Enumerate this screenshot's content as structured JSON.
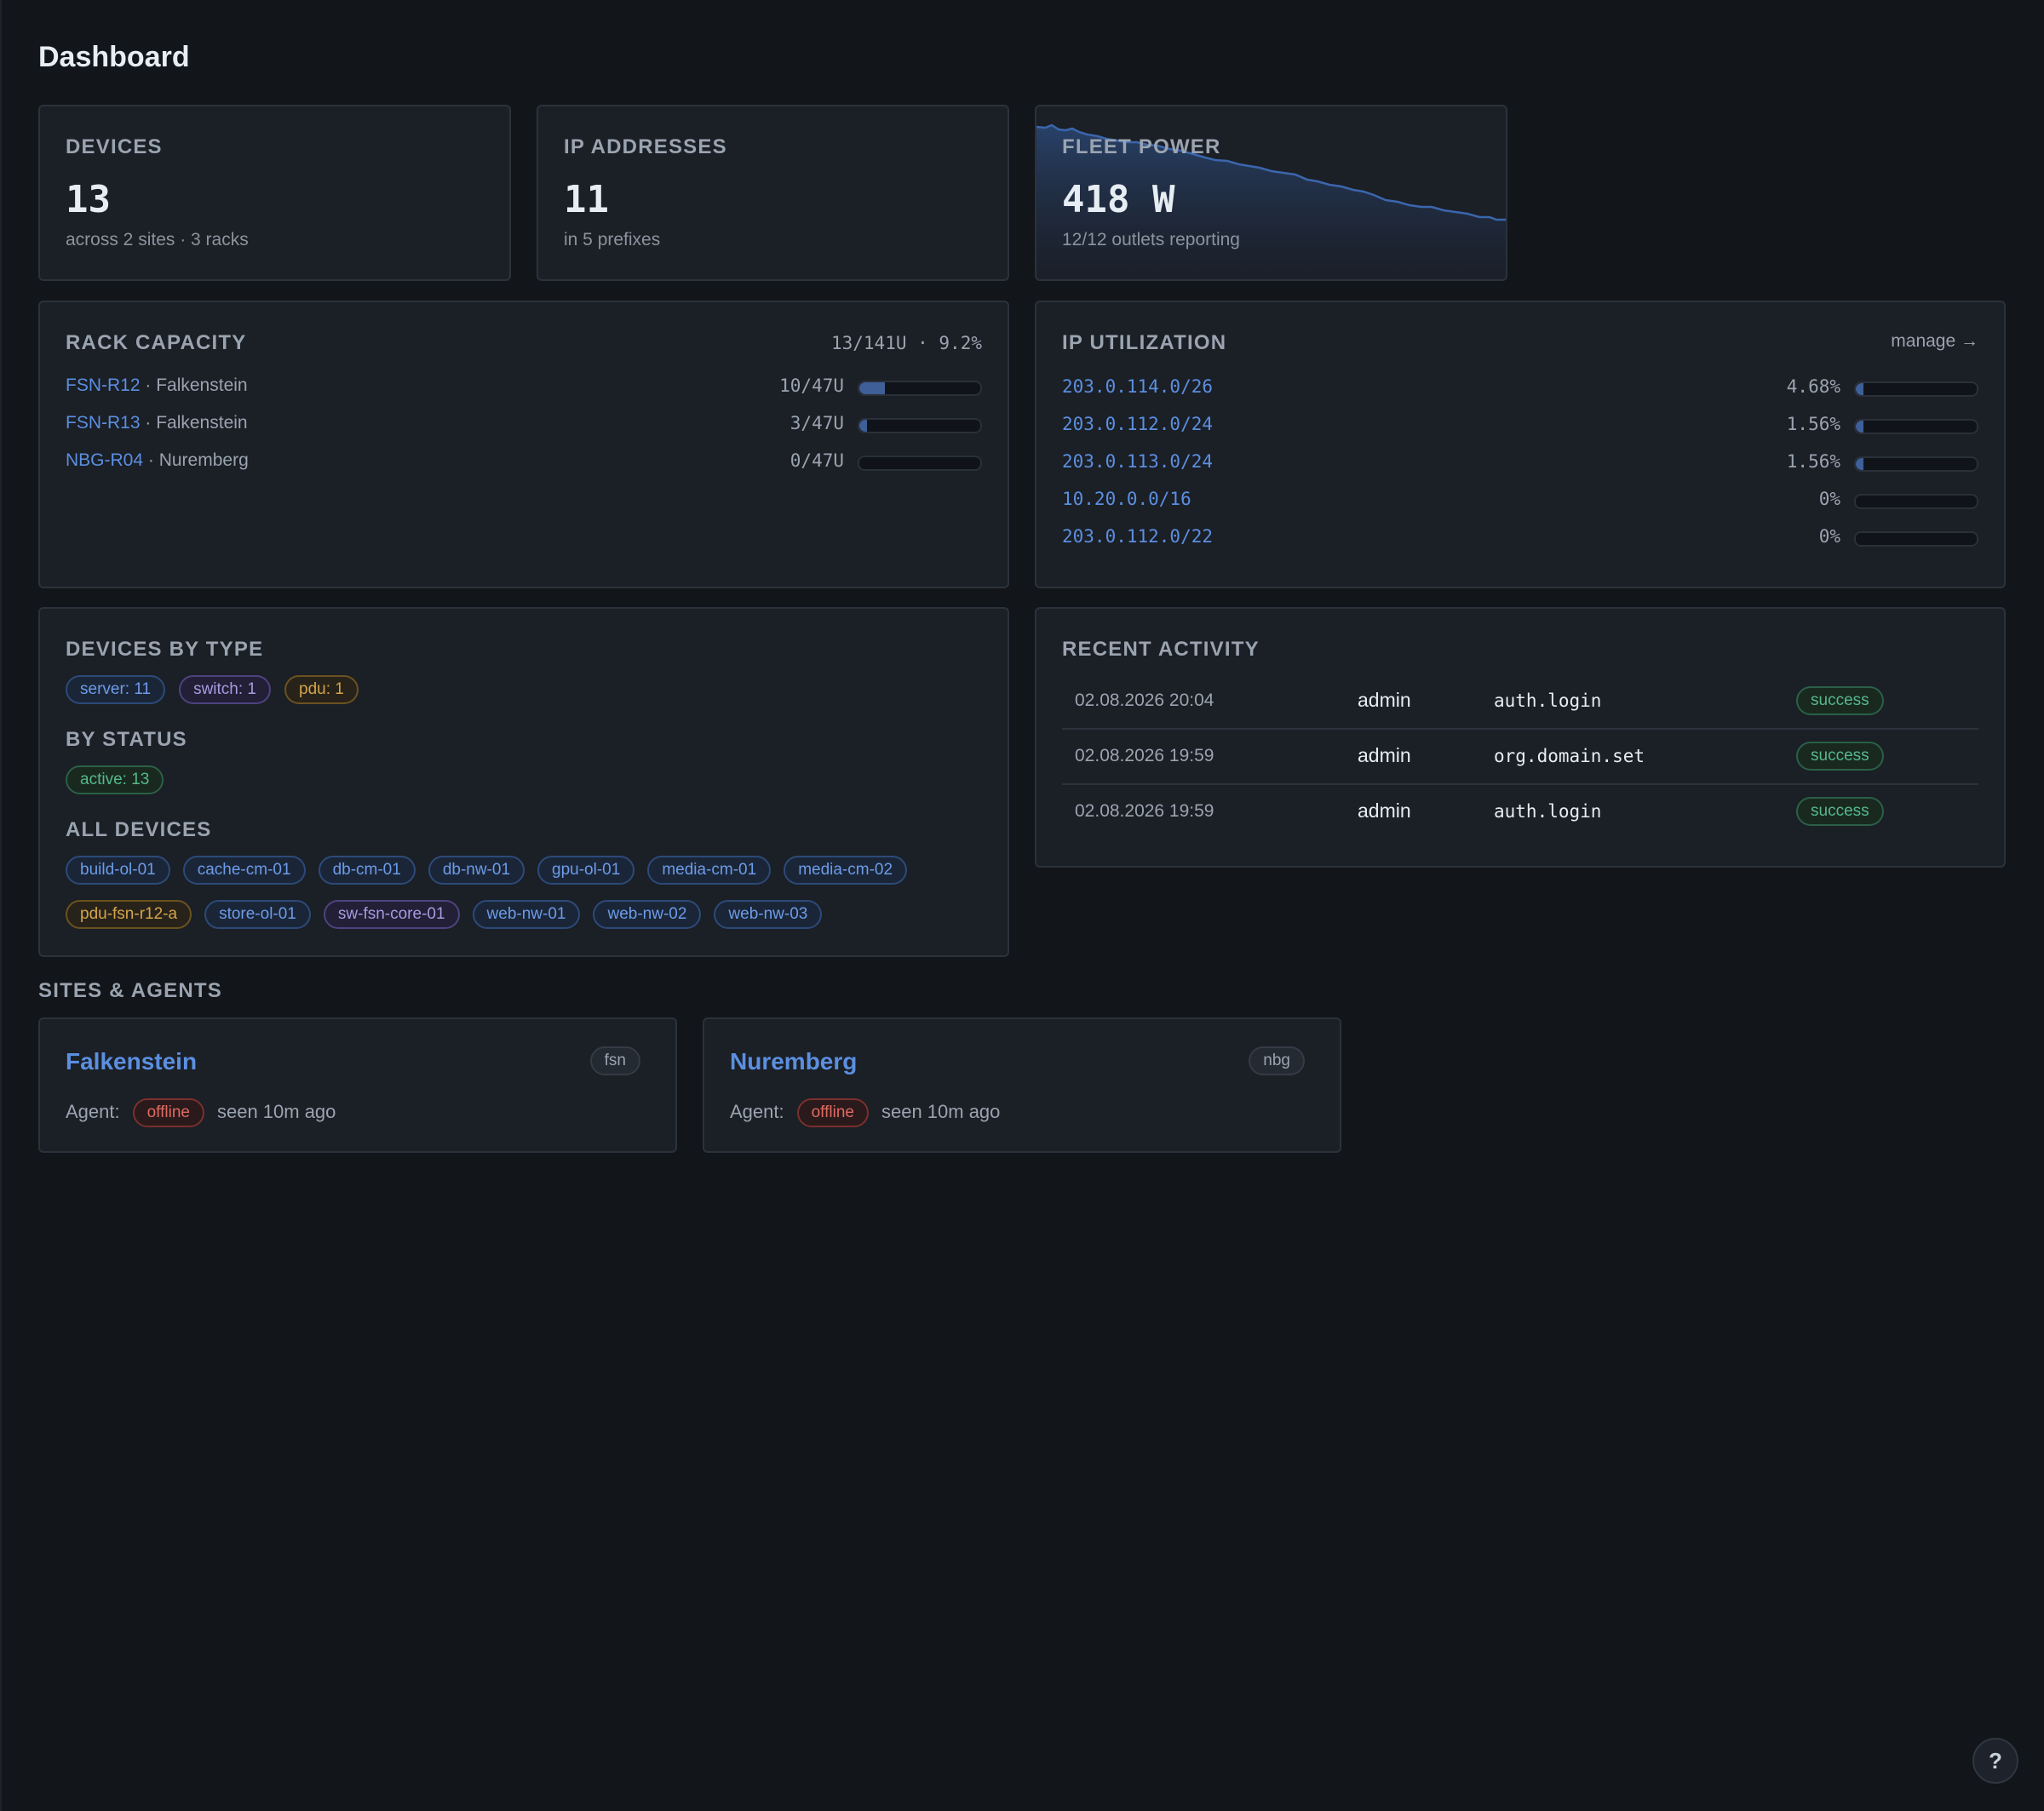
{
  "page": {
    "title": "Dashboard"
  },
  "stats": {
    "devices": {
      "label": "DEVICES",
      "value": "13",
      "sub": "across 2 sites · 3 racks"
    },
    "ips": {
      "label": "IP ADDRESSES",
      "value": "11",
      "sub": "in 5 prefixes"
    },
    "power": {
      "label": "FLEET POWER",
      "value": "418 W",
      "sub": "12/12 outlets reporting"
    }
  },
  "rack_capacity": {
    "label": "RACK CAPACITY",
    "summary": "13/141U · 9.2%",
    "racks": [
      {
        "name": "FSN-R12",
        "site": "· Falkenstein",
        "usage": "10/47U",
        "fraction": 0.2128
      },
      {
        "name": "FSN-R13",
        "site": "· Falkenstein",
        "usage": "3/47U",
        "fraction": 0.0638
      },
      {
        "name": "NBG-R04",
        "site": "· Nuremberg",
        "usage": "0/47U",
        "fraction": 0
      }
    ]
  },
  "ip_utilization": {
    "label": "IP UTILIZATION",
    "manage_label": "manage →",
    "prefixes": [
      {
        "prefix": "203.0.114.0/26",
        "pct": "4.68%",
        "fraction": 0.0468
      },
      {
        "prefix": "203.0.112.0/24",
        "pct": "1.56%",
        "fraction": 0.0156
      },
      {
        "prefix": "203.0.113.0/24",
        "pct": "1.56%",
        "fraction": 0.0156
      },
      {
        "prefix": "10.20.0.0/16",
        "pct": "0%",
        "fraction": 0
      },
      {
        "prefix": "203.0.112.0/22",
        "pct": "0%",
        "fraction": 0
      }
    ]
  },
  "devices_by_type": {
    "label": "DEVICES BY TYPE",
    "types": [
      "server: 11",
      "switch: 1",
      "pdu: 1"
    ],
    "status_label": "BY STATUS",
    "statuses": [
      "active: 13"
    ],
    "all_label": "ALL DEVICES",
    "devices_row1": [
      "build-ol-01",
      "cache-cm-01",
      "db-cm-01",
      "db-nw-01",
      "gpu-ol-01",
      "media-cm-01",
      "media-cm-02"
    ],
    "devices_row2": [
      "pdu-fsn-r12-a",
      "store-ol-01",
      "sw-fsn-core-01",
      "web-nw-01",
      "web-nw-02",
      "web-nw-03"
    ]
  },
  "recent_activity": {
    "label": "RECENT ACTIVITY",
    "rows": [
      {
        "ts": "02.08.2026 20:04",
        "user": "admin",
        "action": "auth.login",
        "status": "success"
      },
      {
        "ts": "02.08.2026 19:59",
        "user": "admin",
        "action": "org.domain.set",
        "status": "success"
      },
      {
        "ts": "02.08.2026 19:59",
        "user": "admin",
        "action": "auth.login",
        "status": "success"
      }
    ]
  },
  "sites": {
    "label": "SITES & AGENTS",
    "items": [
      {
        "name": "Falkenstein",
        "code": "fsn",
        "agent_label": "Agent:",
        "agent_status": "offline",
        "seen": "seen 10m ago"
      },
      {
        "name": "Nuremberg",
        "code": "nbg",
        "agent_label": "Agent:",
        "agent_status": "offline",
        "seen": "seen 10m ago"
      }
    ]
  },
  "help": {
    "label": "?"
  },
  "colors": {
    "accent": "#5b8fe0",
    "background": "#121519",
    "card": "#1b1f26",
    "success": "#56b98a",
    "danger": "#e06a62"
  }
}
